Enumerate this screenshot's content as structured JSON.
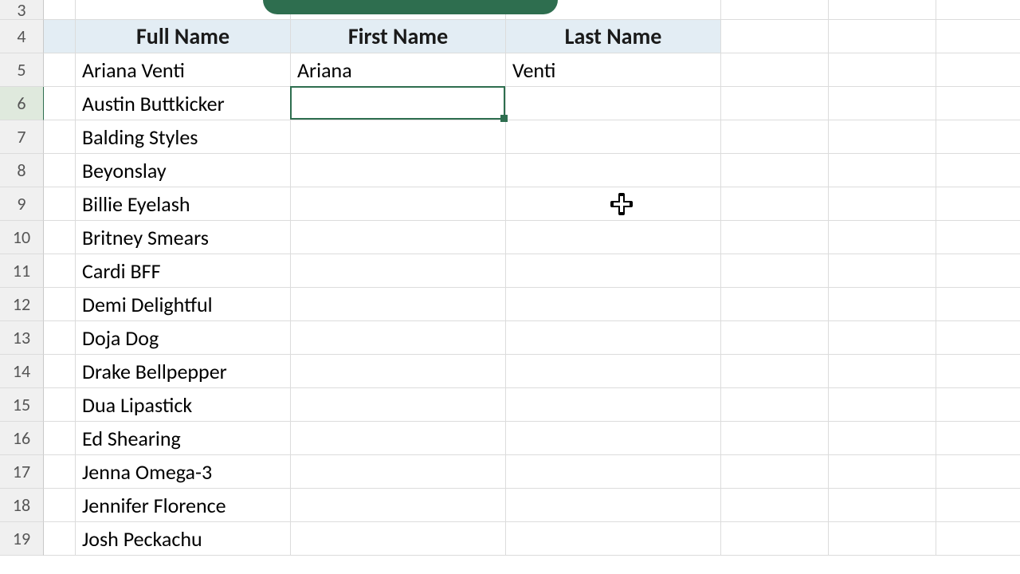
{
  "row_numbers": [
    3,
    4,
    5,
    6,
    7,
    8,
    9,
    10,
    11,
    12,
    13,
    14,
    15,
    16,
    17,
    18,
    19
  ],
  "selected_row_number": 6,
  "headers": {
    "full_name": "Full Name",
    "first_name": "First Name",
    "last_name": "Last Name"
  },
  "rows": [
    {
      "full": "Ariana Venti",
      "first": "Ariana",
      "last": "Venti"
    },
    {
      "full": "Austin Buttkicker",
      "first": "",
      "last": ""
    },
    {
      "full": "Balding Styles",
      "first": "",
      "last": ""
    },
    {
      "full": "Beyonslay",
      "first": "",
      "last": ""
    },
    {
      "full": "Billie Eyelash",
      "first": "",
      "last": ""
    },
    {
      "full": "Britney Smears",
      "first": "",
      "last": ""
    },
    {
      "full": "Cardi BFF",
      "first": "",
      "last": ""
    },
    {
      "full": "Demi Delightful",
      "first": "",
      "last": ""
    },
    {
      "full": "Doja Dog",
      "first": "",
      "last": ""
    },
    {
      "full": "Drake Bellpepper",
      "first": "",
      "last": ""
    },
    {
      "full": "Dua Lipastick",
      "first": "",
      "last": ""
    },
    {
      "full": "Ed Shearing",
      "first": "",
      "last": ""
    },
    {
      "full": "Jenna Omega-3",
      "first": "",
      "last": ""
    },
    {
      "full": "Jennifer Florence",
      "first": "",
      "last": ""
    },
    {
      "full": "Josh Peckachu",
      "first": "",
      "last": ""
    }
  ],
  "active_cell": {
    "col": "C",
    "row": 6
  },
  "hover_cursor_cell": {
    "col": "D",
    "row": 9
  }
}
